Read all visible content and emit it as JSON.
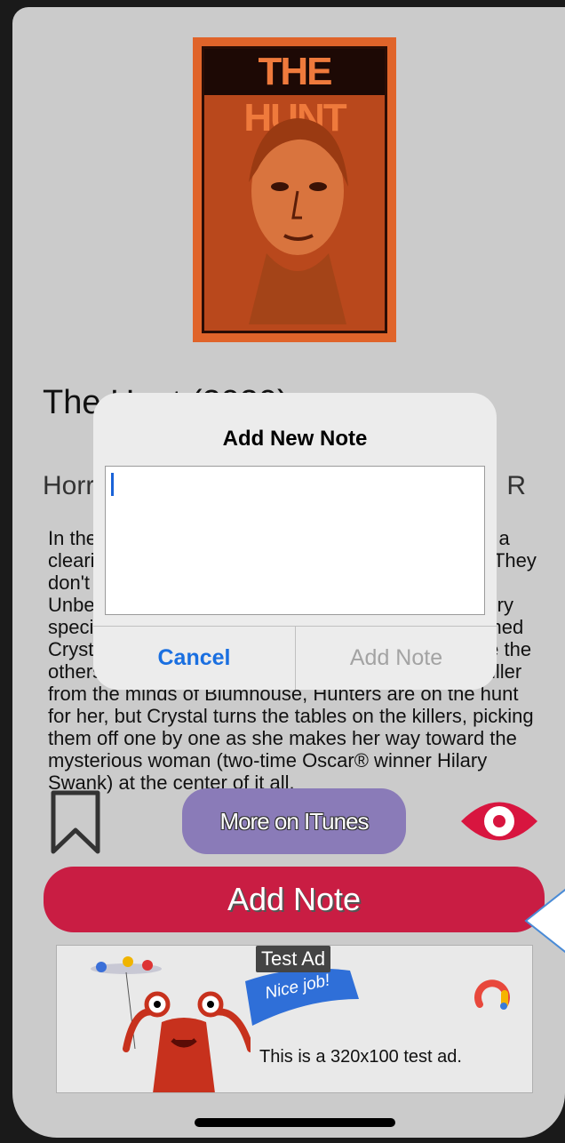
{
  "movie": {
    "poster_title": "THE HUNT",
    "title": "The Hunt (2020)",
    "genre": "Horror",
    "rating": "R",
    "description": "In the debut thriller, a group of strangers wake up in a clearing in an unknown place for the very first time. They don't know where they are or how they got there. Unbeknownst to them, they've been chosen for a very specific purpose: The Hunt. An ordinary woman named Crystal (Betty Gilpin) is one of the victims, but unlike the others, she masters the game plan. In the debut thriller from the minds of Blumhouse, Hunters are on the hunt for her, but Crystal turns the tables on the killers, picking them off one by one as she makes her way toward the mysterious woman (two-time Oscar® winner Hilary Swank) at the center of it all."
  },
  "actions": {
    "itunes_label": "More on ITunes",
    "add_note_label": "Add Note"
  },
  "ad": {
    "label": "Test Ad",
    "flag_text": "Nice job!",
    "text": "This is a 320x100 test ad."
  },
  "dialog": {
    "title": "Add New Note",
    "input_value": "",
    "cancel_label": "Cancel",
    "confirm_label": "Add Note"
  },
  "colors": {
    "accent": "#c91d43",
    "itunes": "#8a7bb8",
    "cancel": "#1a6fe0"
  }
}
